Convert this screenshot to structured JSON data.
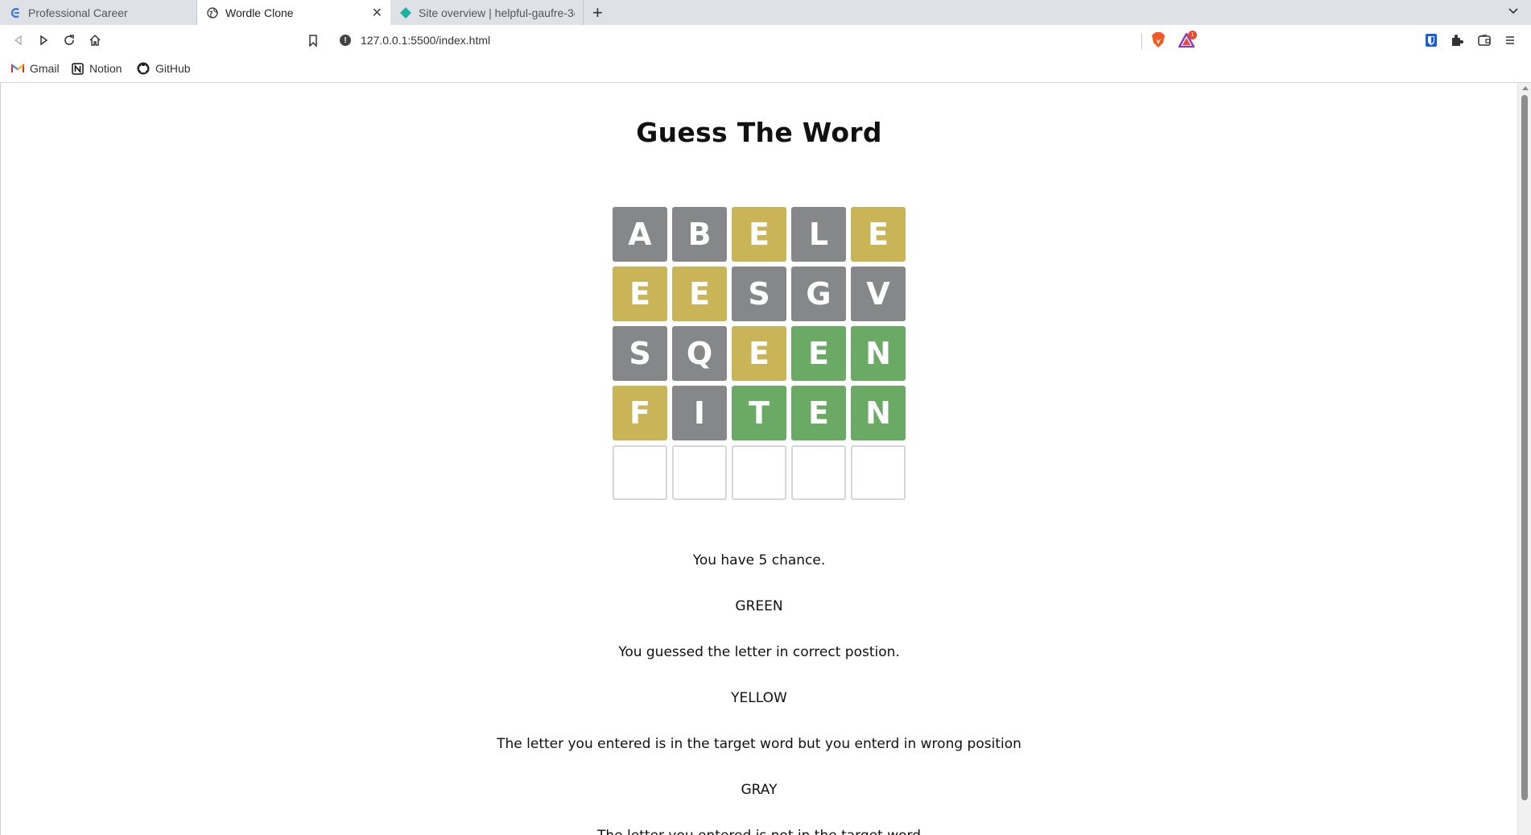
{
  "tabs": [
    {
      "label": "Professional Career",
      "active": false,
      "favicon": "career-icon"
    },
    {
      "label": "Wordle Clone",
      "active": true,
      "favicon": "globe-icon"
    },
    {
      "label": "Site overview | helpful-gaufre-3d",
      "active": false,
      "favicon": "netlify-icon"
    }
  ],
  "toolbar": {
    "url": "127.0.0.1:5500/index.html"
  },
  "bookmarks": [
    {
      "label": "Gmail",
      "icon": "gmail-icon"
    },
    {
      "label": "Notion",
      "icon": "notion-icon"
    },
    {
      "label": "GitHub",
      "icon": "github-icon"
    }
  ],
  "rewards_badge": "1",
  "page": {
    "title": "Guess The Word",
    "board": [
      [
        {
          "letter": "A",
          "state": "gray"
        },
        {
          "letter": "B",
          "state": "gray"
        },
        {
          "letter": "E",
          "state": "yellow"
        },
        {
          "letter": "L",
          "state": "gray"
        },
        {
          "letter": "E",
          "state": "yellow"
        }
      ],
      [
        {
          "letter": "E",
          "state": "yellow"
        },
        {
          "letter": "E",
          "state": "yellow"
        },
        {
          "letter": "S",
          "state": "gray"
        },
        {
          "letter": "G",
          "state": "gray"
        },
        {
          "letter": "V",
          "state": "gray"
        }
      ],
      [
        {
          "letter": "S",
          "state": "gray"
        },
        {
          "letter": "Q",
          "state": "gray"
        },
        {
          "letter": "E",
          "state": "yellow"
        },
        {
          "letter": "E",
          "state": "green"
        },
        {
          "letter": "N",
          "state": "green"
        }
      ],
      [
        {
          "letter": "F",
          "state": "yellow"
        },
        {
          "letter": "I",
          "state": "gray"
        },
        {
          "letter": "T",
          "state": "green"
        },
        {
          "letter": "E",
          "state": "green"
        },
        {
          "letter": "N",
          "state": "green"
        }
      ],
      [
        {
          "letter": "",
          "state": "empty"
        },
        {
          "letter": "",
          "state": "empty"
        },
        {
          "letter": "",
          "state": "empty"
        },
        {
          "letter": "",
          "state": "empty"
        },
        {
          "letter": "",
          "state": "empty"
        }
      ]
    ],
    "chances_text": "You have 5 chance.",
    "green_heading": "GREEN",
    "green_desc": "You guessed the letter in correct postion.",
    "yellow_heading": "YELLOW",
    "yellow_desc": "The letter you entered is in the target word but you enterd in wrong position",
    "gray_heading": "GRAY",
    "gray_desc": "The letter you entered is not in the target word"
  },
  "colors": {
    "gray": "#858789",
    "yellow": "#c9b458",
    "green": "#6aaa64"
  }
}
